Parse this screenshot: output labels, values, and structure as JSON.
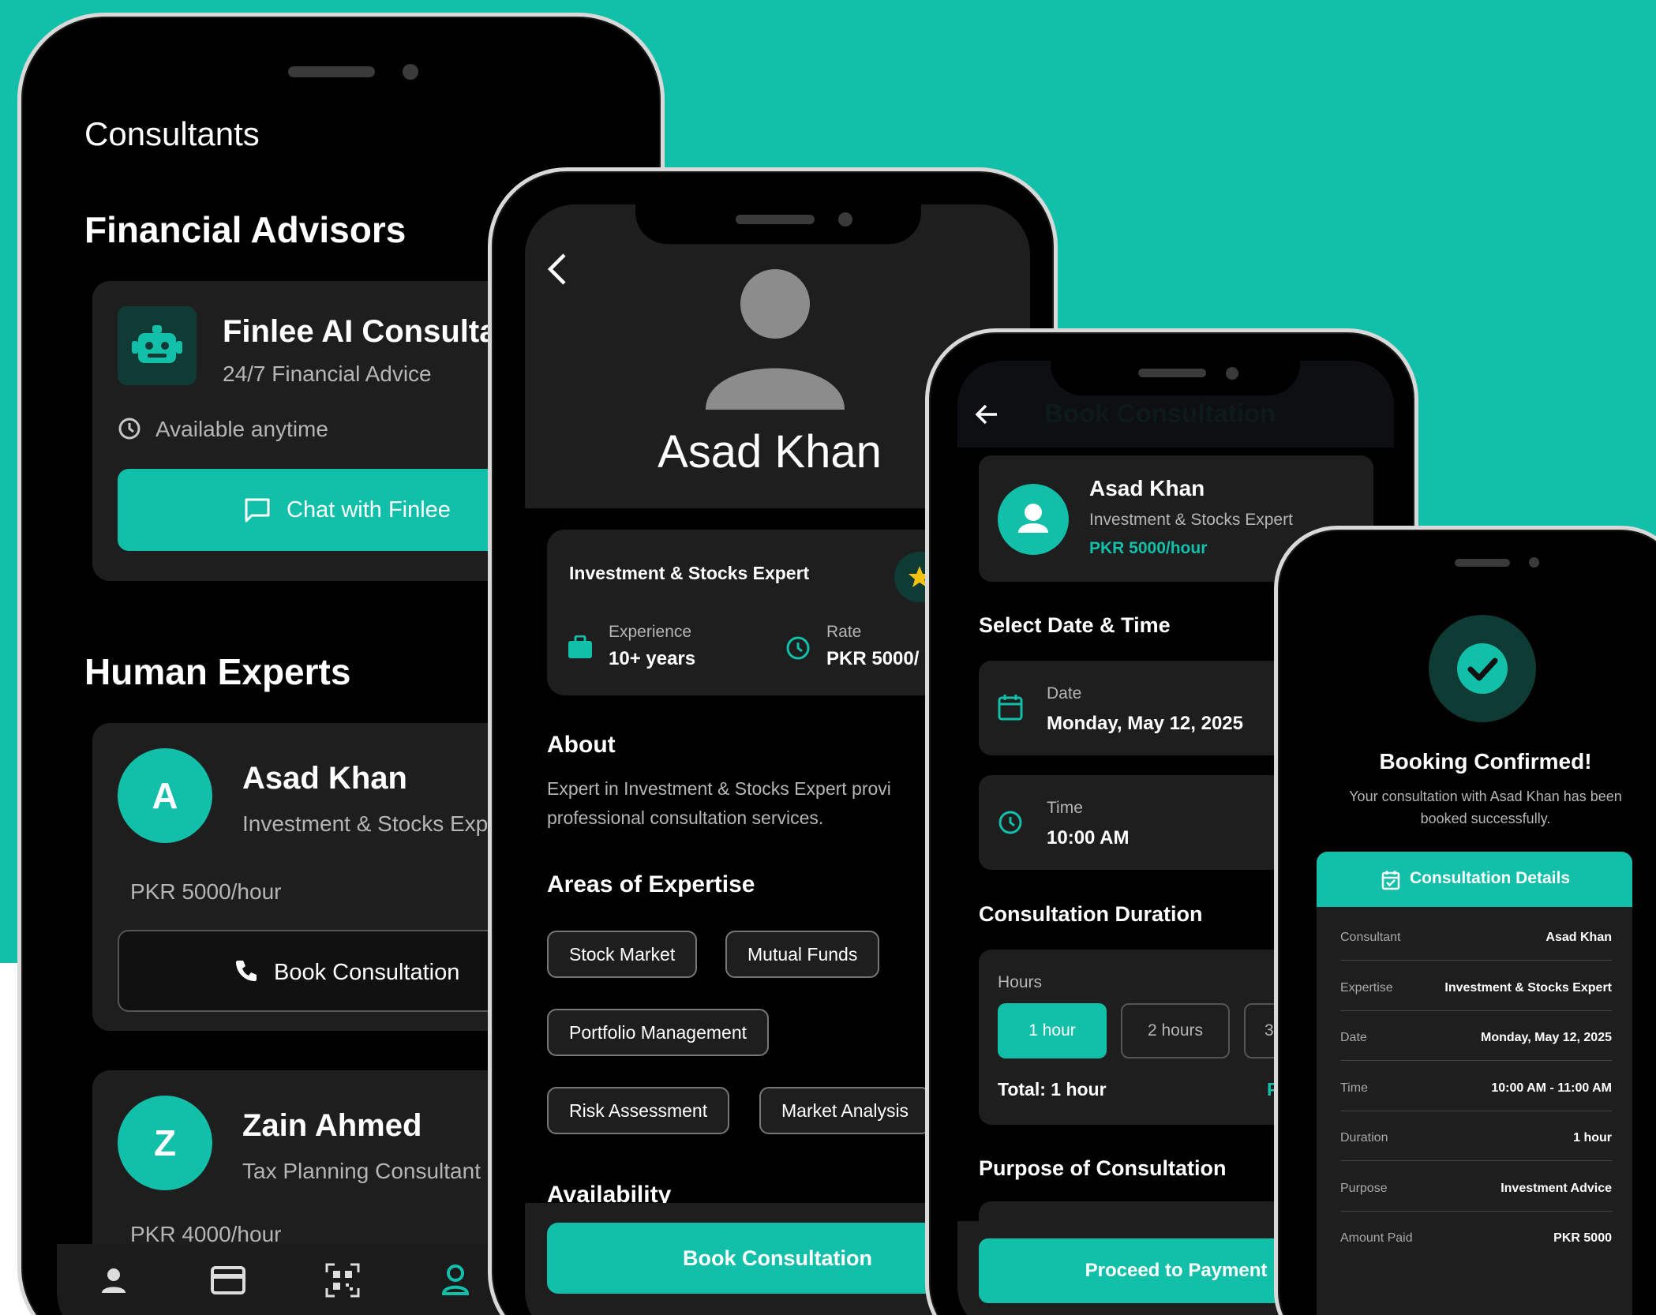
{
  "phone1": {
    "title": "Consultants",
    "section_ai": "Financial Advisors",
    "ai_card": {
      "name": "Finlee AI Consulta",
      "subtitle": "24/7 Financial Advice",
      "availability": "Available anytime",
      "button": "Chat with Finlee"
    },
    "section_human": "Human Experts",
    "experts": [
      {
        "initial": "A",
        "name": "Asad Khan",
        "specialty": "Investment & Stocks Exp",
        "rate": "PKR 5000/hour",
        "button": "Book Consultation"
      },
      {
        "initial": "Z",
        "name": "Zain Ahmed",
        "specialty": "Tax Planning Consultant",
        "rate": "PKR 4000/hour"
      }
    ],
    "nav": [
      "person-icon",
      "card-icon",
      "qr-icon",
      "profile-icon"
    ]
  },
  "phone2": {
    "name": "Asad Khan",
    "card_title": "Investment & Stocks Expert",
    "experience_label": "Experience",
    "experience_value": "10+ years",
    "rate_label": "Rate",
    "rate_value": "PKR 5000/",
    "about_heading": "About",
    "about_text_1": "Expert in Investment & Stocks Expert provi",
    "about_text_2": "professional consultation services.",
    "expertise_heading": "Areas of Expertise",
    "tags": [
      "Stock Market",
      "Mutual Funds",
      "Portfolio Management",
      "Risk Assessment",
      "Market Analysis"
    ],
    "availability_heading": "Availability",
    "button": "Book Consultation"
  },
  "phone3": {
    "header_title": "Book Consultation",
    "consultant_name": "Asad Khan",
    "consultant_role": "Investment & Stocks Expert",
    "consultant_rate": "PKR 5000/hour",
    "date_time_heading": "Select Date & Time",
    "date_label": "Date",
    "date_value": "Monday, May 12, 2025",
    "time_label": "Time",
    "time_value": "10:00 AM",
    "duration_heading": "Consultation Duration",
    "hours_label": "Hours",
    "hour_options": [
      "1 hour",
      "2 hours",
      "3"
    ],
    "total": "Total: 1 hour",
    "total_price_fragment": "P",
    "purpose_heading": "Purpose of Consultation",
    "button": "Proceed to Payment"
  },
  "phone4": {
    "title": "Booking Confirmed!",
    "message_1": "Your consultation with Asad Khan has been",
    "message_2": "booked successfully.",
    "details_heading": "Consultation Details",
    "rows": [
      {
        "label": "Consultant",
        "value": "Asad Khan"
      },
      {
        "label": "Expertise",
        "value": "Investment & Stocks Expert"
      },
      {
        "label": "Date",
        "value": "Monday, May 12, 2025"
      },
      {
        "label": "Time",
        "value": "10:00 AM - 11:00 AM"
      },
      {
        "label": "Duration",
        "value": "1 hour"
      },
      {
        "label": "Purpose",
        "value": "Investment Advice"
      },
      {
        "label": "Amount Paid",
        "value": "PKR 5000"
      }
    ]
  },
  "colors": {
    "accent": "#12bfa8",
    "card": "#1e1e1e",
    "background": "#000000"
  }
}
